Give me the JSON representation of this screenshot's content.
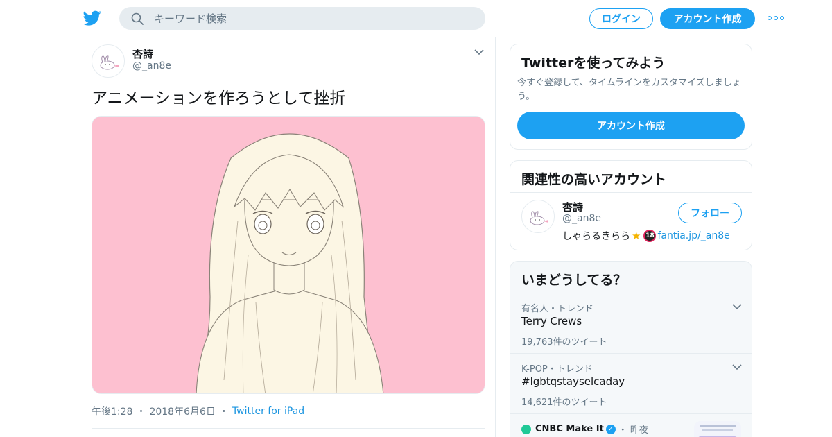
{
  "header": {
    "search_placeholder": "キーワード検索",
    "login_label": "ログイン",
    "signup_label": "アカウント作成"
  },
  "tweet": {
    "display_name": "杏詩",
    "screen_name": "@_an8e",
    "text": "アニメーションを作ろうとして挫折",
    "time": "午後1:28",
    "date": "2018年6月6日",
    "source": "Twitter for iPad"
  },
  "signup_card": {
    "title": "Twitterを使ってみよう",
    "description": "今すぐ登録して、タイムラインをカスタマイズしましょう。",
    "button_label": "アカウント作成"
  },
  "related": {
    "title": "関連性の高いアカウント",
    "accounts": [
      {
        "display_name": "杏詩",
        "screen_name": "@_an8e",
        "follow_label": "フォロー",
        "bio_text": "しゃらるきらら",
        "bio_badge": "18",
        "bio_link": "fantia.jp/_an8e"
      }
    ]
  },
  "trends": {
    "title": "いまどうしてる？",
    "items": [
      {
        "meta": "有名人・トレンド",
        "name": "Terry Crews",
        "count": "19,763件のツイート"
      },
      {
        "meta": "K-POP・トレンド",
        "name": "#lgbtqstayselcaday",
        "count": "14,621件のツイート"
      }
    ],
    "news": {
      "source": "CNBC Make It",
      "time": "昨夜"
    }
  },
  "colors": {
    "accent": "#1da1f2",
    "link": "#1b95e0",
    "muted": "#657786",
    "media_bg": "#fdc0d0"
  }
}
